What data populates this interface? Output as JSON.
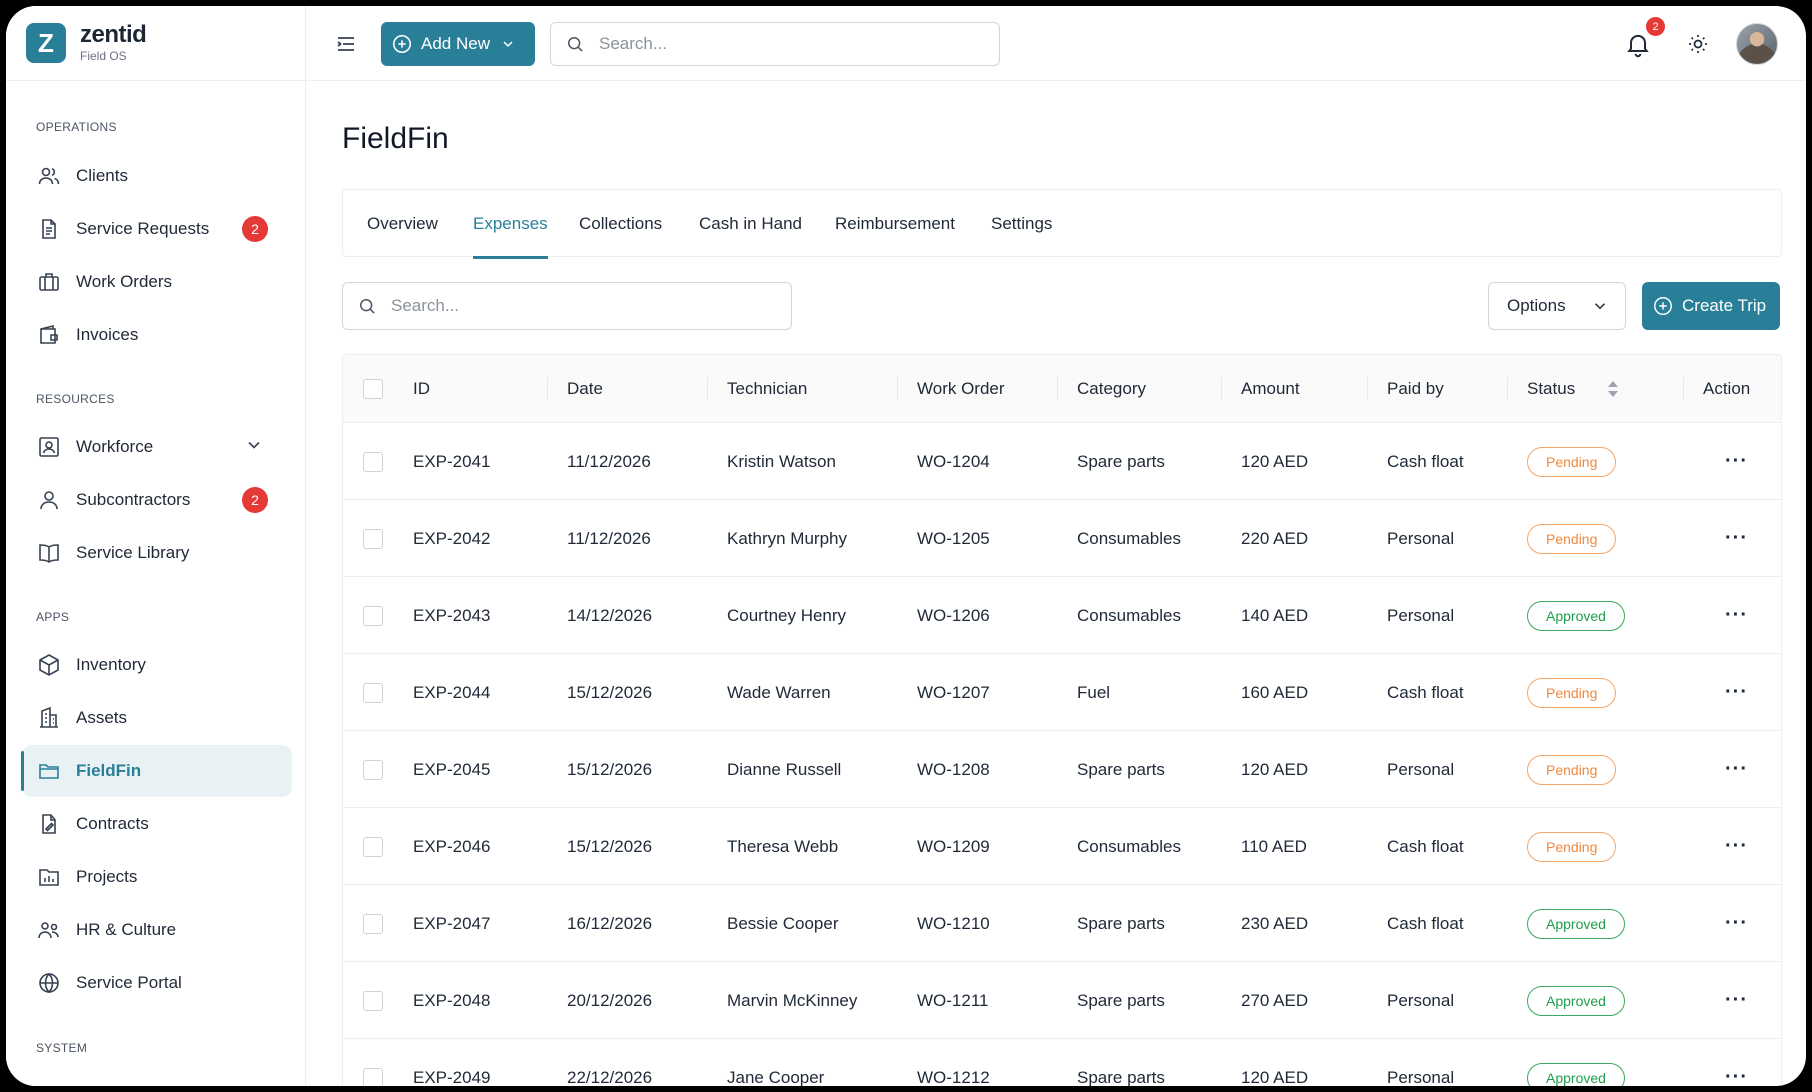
{
  "brand": {
    "logo_letter": "Z",
    "name": "zentid",
    "subtitle": "Field OS"
  },
  "sidebar": {
    "sections": {
      "operations": "OPERATIONS",
      "resources": "RESOURCES",
      "apps": "APPS",
      "system": "SYSTEM"
    },
    "items": [
      {
        "label": "Clients",
        "icon": "users-icon"
      },
      {
        "label": "Service Requests",
        "icon": "document-icon",
        "badge": "2"
      },
      {
        "label": "Work Orders",
        "icon": "briefcase-icon"
      },
      {
        "label": "Invoices",
        "icon": "wallet-icon"
      },
      {
        "label": "Workforce",
        "icon": "id-card-icon"
      },
      {
        "label": "Subcontractors",
        "icon": "user-icon",
        "badge": "2"
      },
      {
        "label": "Service Library",
        "icon": "book-icon"
      },
      {
        "label": "Inventory",
        "icon": "cube-icon"
      },
      {
        "label": "Assets",
        "icon": "building-icon"
      },
      {
        "label": "FieldFin",
        "icon": "folder-icon",
        "active": true
      },
      {
        "label": "Contracts",
        "icon": "contract-icon"
      },
      {
        "label": "Projects",
        "icon": "chart-folder-icon"
      },
      {
        "label": "HR & Culture",
        "icon": "team-icon"
      },
      {
        "label": "Service Portal",
        "icon": "globe-icon"
      }
    ]
  },
  "topbar": {
    "add_new_label": "Add New",
    "search_placeholder": "Search...",
    "notification_count": "2"
  },
  "page": {
    "title": "FieldFin",
    "tabs": [
      "Overview",
      "Expenses",
      "Collections",
      "Cash in Hand",
      "Reimbursement",
      "Settings"
    ],
    "active_tab": "Expenses",
    "search_placeholder": "Search...",
    "options_label": "Options",
    "create_label": "Create Trip"
  },
  "table": {
    "columns": [
      "ID",
      "Date",
      "Technician",
      "Work Order",
      "Category",
      "Amount",
      "Paid by",
      "Status",
      "Action"
    ],
    "rows": [
      {
        "id": "EXP-2041",
        "date": "11/12/2026",
        "tech": "Kristin Watson",
        "wo": "WO-1204",
        "cat": "Spare parts",
        "amount": "120 AED",
        "paid": "Cash float",
        "status": "Pending"
      },
      {
        "id": "EXP-2042",
        "date": "11/12/2026",
        "tech": "Kathryn Murphy",
        "wo": "WO-1205",
        "cat": "Consumables",
        "amount": "220 AED",
        "paid": "Personal",
        "status": "Pending"
      },
      {
        "id": "EXP-2043",
        "date": "14/12/2026",
        "tech": "Courtney Henry",
        "wo": "WO-1206",
        "cat": "Consumables",
        "amount": "140 AED",
        "paid": "Personal",
        "status": "Approved"
      },
      {
        "id": "EXP-2044",
        "date": "15/12/2026",
        "tech": "Wade Warren",
        "wo": "WO-1207",
        "cat": "Fuel",
        "amount": "160 AED",
        "paid": "Cash float",
        "status": "Pending"
      },
      {
        "id": "EXP-2045",
        "date": "15/12/2026",
        "tech": "Dianne Russell",
        "wo": "WO-1208",
        "cat": "Spare parts",
        "amount": "120 AED",
        "paid": "Personal",
        "status": "Pending"
      },
      {
        "id": "EXP-2046",
        "date": "15/12/2026",
        "tech": "Theresa Webb",
        "wo": "WO-1209",
        "cat": "Consumables",
        "amount": "110 AED",
        "paid": "Cash float",
        "status": "Pending"
      },
      {
        "id": "EXP-2047",
        "date": "16/12/2026",
        "tech": "Bessie Cooper",
        "wo": "WO-1210",
        "cat": "Spare parts",
        "amount": "230 AED",
        "paid": "Cash float",
        "status": "Approved"
      },
      {
        "id": "EXP-2048",
        "date": "20/12/2026",
        "tech": "Marvin McKinney",
        "wo": "WO-1211",
        "cat": "Spare parts",
        "amount": "270 AED",
        "paid": "Personal",
        "status": "Approved"
      },
      {
        "id": "EXP-2049",
        "date": "22/12/2026",
        "tech": "Jane Cooper",
        "wo": "WO-1212",
        "cat": "Spare parts",
        "amount": "120 AED",
        "paid": "Personal",
        "status": "Approved"
      }
    ],
    "action_glyph": "···"
  },
  "colors": {
    "brand": "#2a7f98",
    "pending": "#f0883e",
    "approved": "#1e9e4a",
    "badge": "#e53935"
  }
}
